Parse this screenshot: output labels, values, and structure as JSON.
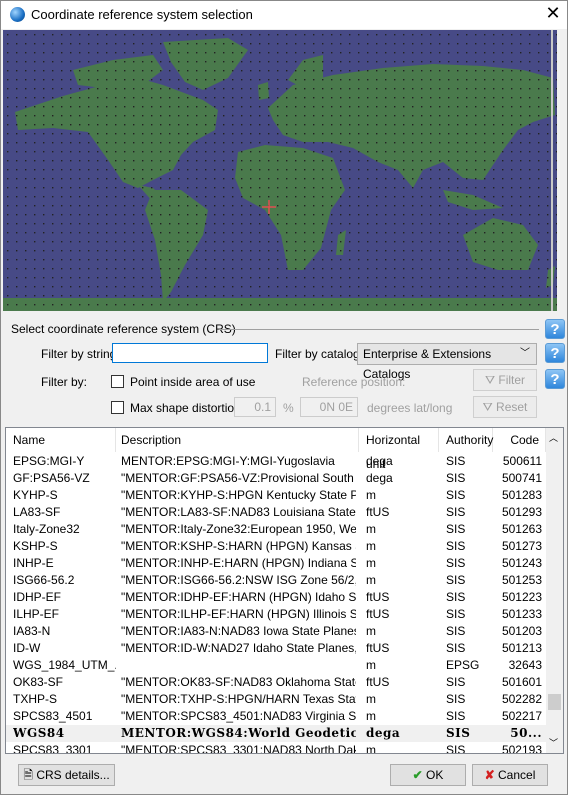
{
  "window": {
    "title": "Coordinate reference system selection",
    "close_icon": "close-icon",
    "app_icon": "globe-icon"
  },
  "map": {
    "ocean_color": "#474a86",
    "land_color": "#4a7a4c",
    "marker_color": "#e05050",
    "marker_position": "0N 0E"
  },
  "crs_group": {
    "label": "Select coordinate reference system (CRS)"
  },
  "filter": {
    "string_label": "Filter by string:",
    "string_value": "",
    "catalog_label": "Filter by catalog:",
    "catalog_value": "Enterprise & Extensions Catalogs",
    "filter_by_label": "Filter by:",
    "point_inside_label": "Point inside area of use",
    "point_inside_checked": false,
    "reference_position_label": "Reference position:",
    "max_shape_label": "Max shape distortion:",
    "max_shape_checked": false,
    "distortion_value": "0.1",
    "percent_label": "%",
    "position_value": "0N 0E",
    "degrees_label": "degrees lat/long",
    "filter_button": "Filter",
    "reset_button": "Reset"
  },
  "table": {
    "columns": [
      "Name",
      "Description",
      "Horizontal unit",
      "Authority",
      "Code"
    ],
    "rows": [
      [
        "EPSG:MGI-Y",
        "MENTOR:EPSG:MGI-Y:MGI-Yugoslavia",
        "dega",
        "SIS",
        "500611"
      ],
      [
        "GF:PSA56-VZ",
        "\"MENTOR:GF:PSA56-VZ:Provisional South A...",
        "dega",
        "SIS",
        "500741"
      ],
      [
        "KYHP-S",
        "\"MENTOR:KYHP-S:HPGN Kentucky State Pla...",
        "m",
        "SIS",
        "501283"
      ],
      [
        "LA83-SF",
        "\"MENTOR:LA83-SF:NAD83 Louisiana State Pl...",
        "ftUS",
        "SIS",
        "501293"
      ],
      [
        "Italy-Zone32",
        "\"MENTOR:Italy-Zone32:European 1950, West...",
        "m",
        "SIS",
        "501263"
      ],
      [
        "KSHP-S",
        "\"MENTOR:KSHP-S:HARN (HPGN) Kansas St...",
        "m",
        "SIS",
        "501273"
      ],
      [
        "INHP-E",
        "\"MENTOR:INHP-E:HARN (HPGN) Indiana Sta...",
        "m",
        "SIS",
        "501243"
      ],
      [
        "ISG66-56.2",
        "\"MENTOR:ISG66-56.2:NSW ISG Zone 56/2, ...",
        "m",
        "SIS",
        "501253"
      ],
      [
        "IDHP-EF",
        "\"MENTOR:IDHP-EF:HARN (HPGN) Idaho Stat...",
        "ftUS",
        "SIS",
        "501223"
      ],
      [
        "ILHP-EF",
        "\"MENTOR:ILHP-EF:HARN (HPGN) Illinois Stat...",
        "ftUS",
        "SIS",
        "501233"
      ],
      [
        "IA83-N",
        "\"MENTOR:IA83-N:NAD83 Iowa State Planes, ...",
        "m",
        "SIS",
        "501203"
      ],
      [
        "ID-W",
        "\"MENTOR:ID-W:NAD27 Idaho State Planes, ...",
        "ftUS",
        "SIS",
        "501213"
      ],
      [
        "WGS_1984_UTM_...",
        "",
        "m",
        "EPSG",
        "32643"
      ],
      [
        "OK83-SF",
        "\"MENTOR:OK83-SF:NAD83 Oklahoma State ...",
        "ftUS",
        "SIS",
        "501601"
      ],
      [
        "TXHP-S",
        "\"MENTOR:TXHP-S:HPGN/HARN Texas Stat...",
        "m",
        "SIS",
        "502282"
      ],
      [
        "SPCS83_4501",
        "\"MENTOR:SPCS83_4501:NAD83 Virginia Stat...",
        "m",
        "SIS",
        "502217"
      ],
      [
        "WGS84",
        "MENTOR:WGS84:World Geodetic Sy...",
        "dega",
        "SIS",
        "50..."
      ],
      [
        "SPCS83_3301",
        "\"MENTOR:SPCS83_3301:NAD83 North Dako...",
        "m",
        "SIS",
        "502193"
      ]
    ],
    "selected_row": 16
  },
  "footer": {
    "crs_details": "CRS details...",
    "ok": "OK",
    "cancel": "Cancel"
  }
}
